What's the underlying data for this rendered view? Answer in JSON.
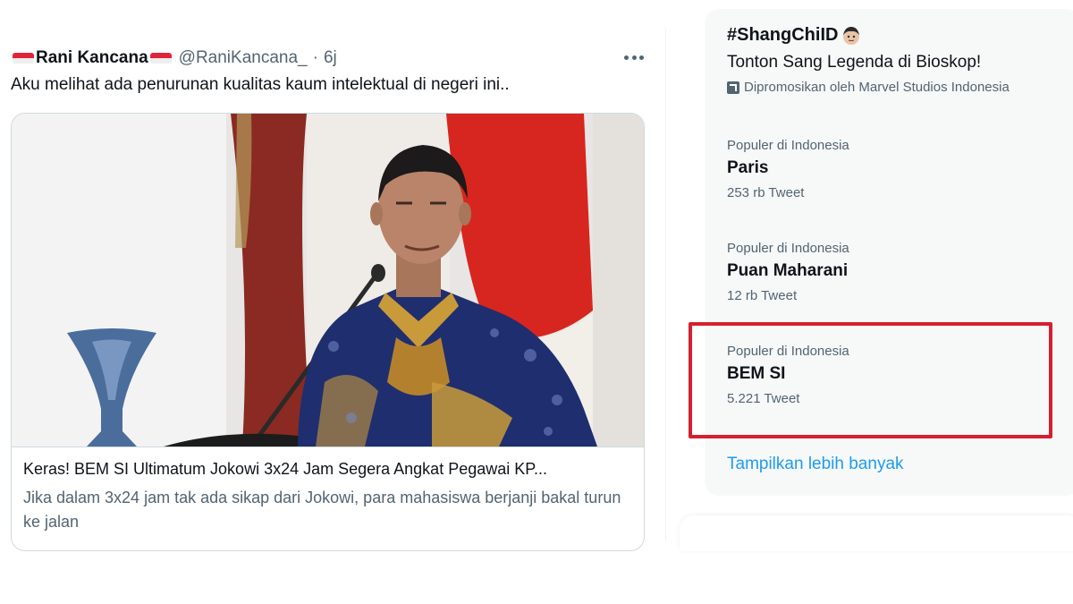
{
  "tweet": {
    "author_name": "Rani Kancana",
    "author_handle": "@RaniKancana_",
    "separator": "·",
    "time": "6j",
    "text": "Aku melihat ada penurunan kualitas kaum intelektual di negeri ini..",
    "card": {
      "title": "Keras! BEM SI Ultimatum Jokowi 3x24 Jam Segera Angkat Pegawai KP...",
      "description": "Jika dalam 3x24 jam tak ada sikap dari Jokowi, para mahasiswa berjanji bakal turun ke jalan"
    }
  },
  "sidebar": {
    "promoted": {
      "hashtag": "#ShangChiID",
      "title": "Tonton Sang Legenda di Bioskop!",
      "promoted_by": "Dipromosikan oleh Marvel Studios Indonesia"
    },
    "trends": [
      {
        "context": "Populer di Indonesia",
        "name": "Paris",
        "count": "253 rb Tweet"
      },
      {
        "context": "Populer di Indonesia",
        "name": "Puan Maharani",
        "count": "12 rb Tweet"
      },
      {
        "context": "Populer di Indonesia",
        "name": "BEM SI",
        "count": "5.221 Tweet"
      }
    ],
    "show_more": "Tampilkan lebih banyak"
  },
  "colors": {
    "accent": "#1d9bf0",
    "highlight": "#d42030",
    "muted_text": "#536471"
  }
}
